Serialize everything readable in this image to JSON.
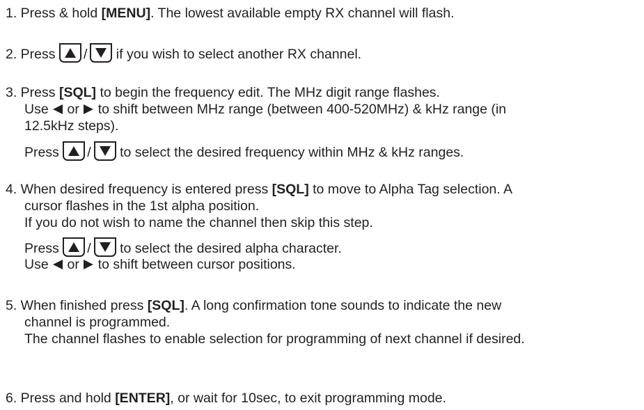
{
  "steps": {
    "s1": {
      "n": "1. Press & hold ",
      "key": "[MENU]",
      "rest": ". The lowest available empty RX channel will flash."
    },
    "s2": {
      "pre": "2. Press ",
      "slash": "/",
      "post": " if you wish to select another RX channel."
    },
    "s3": {
      "a_pre": "3. Press ",
      "a_key": "[SQL]",
      "a_rest": " to begin the frequency edit. The MHz digit range flashes.",
      "b_use": "Use ",
      "b_or": " or ",
      "b_rest": " to shift between MHz range (between 400-520MHz) & kHz range (in",
      "c": "12.5kHz steps).",
      "d_pre": "Press ",
      "d_slash": "/",
      "d_post": " to select the desired frequency within MHz & kHz ranges."
    },
    "s4": {
      "a_pre": "4. When desired frequency is entered press ",
      "a_key": "[SQL]",
      "a_rest": " to move to Alpha Tag selection. A",
      "b": "cursor flashes in the 1st alpha position.",
      "c": "If you do not wish to name the channel then skip this step.",
      "d_pre": "Press ",
      "d_slash": "/",
      "d_post": " to select the desired alpha character.",
      "e_use": "Use ",
      "e_or": " or ",
      "e_rest": " to shift between cursor positions."
    },
    "s5": {
      "a_pre": "5. When finished press ",
      "a_key": "[SQL]",
      "a_rest": ". A long confirmation tone sounds to indicate the new",
      "b": "channel is programmed.",
      "c": "The channel flashes to enable selection for programming of next channel if desired."
    },
    "s6": {
      "pre": "6. Press and hold ",
      "key": "[ENTER]",
      "rest": ", or wait for 10sec, to exit programming mode."
    }
  },
  "icons": {
    "up": "up-arrow-key-icon",
    "down": "down-arrow-key-icon",
    "left": "left-triangle-icon",
    "right": "right-triangle-icon"
  }
}
